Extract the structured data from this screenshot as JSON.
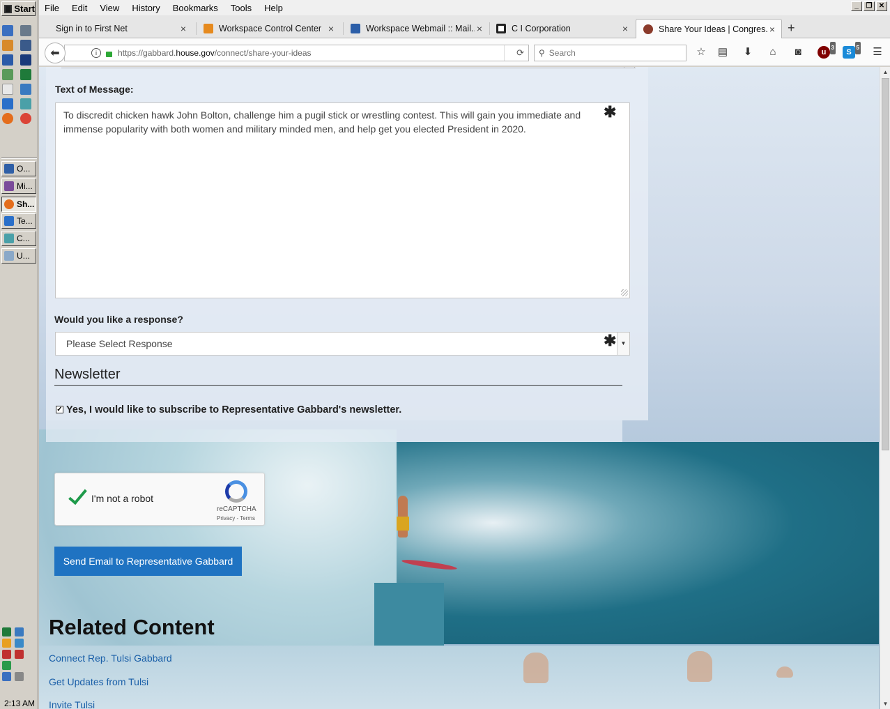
{
  "taskbar": {
    "start_label": "Start",
    "tasks": [
      {
        "label": "O...",
        "color": "#2f5fa6"
      },
      {
        "label": "Mi...",
        "color": "#7a4a9a"
      },
      {
        "label": "Sh...",
        "color": "#e46d1c"
      },
      {
        "label": "Te...",
        "color": "#2a6fc9"
      },
      {
        "label": "C...",
        "color": "#4aa0a8"
      },
      {
        "label": "U...",
        "color": "#8aa8c8"
      }
    ],
    "clock": "2:13 AM"
  },
  "menubar": {
    "items": [
      "File",
      "Edit",
      "View",
      "History",
      "Bookmarks",
      "Tools",
      "Help"
    ]
  },
  "tabs": [
    {
      "label": "Sign in to First Net",
      "close": "×"
    },
    {
      "label": "Workspace Control Center",
      "close": "×",
      "favicon_color": "#e68a1e"
    },
    {
      "label": "Workspace Webmail :: Mail...",
      "close": "×",
      "favicon_color": "#2b5ea8"
    },
    {
      "label": "C I Corporation",
      "close": "×",
      "favicon_color": "#222222"
    },
    {
      "label": "Share Your Ideas | Congres...",
      "close": "×",
      "favicon_color": "#8a3a2a"
    }
  ],
  "newtab_label": "+",
  "navbar": {
    "url_prefix": "https://gabbard.",
    "url_domain": "house.gov",
    "url_path": "/connect/share-your-ideas",
    "search_placeholder": "Search",
    "ublock_count": "3",
    "skype_count": "5"
  },
  "form": {
    "message_label": "Text of Message:",
    "message_text": "To discredit chicken hawk John Bolton, challenge him a pugil stick or wrestling contest.  This will gain you immediate and immense popularity with both women and military minded men, and help get you elected President in 2020.",
    "required_mark": "✱",
    "response_label": "Would you like a response?",
    "response_value": "Please Select Response",
    "newsletter_title": "Newsletter",
    "newsletter_checked": "✓",
    "newsletter_label": "Yes, I would like to subscribe to Representative Gabbard's newsletter.",
    "captcha_label": "I'm not a robot",
    "captcha_brand": "reCAPTCHA",
    "captcha_terms": "Privacy - Terms",
    "send_label": "Send Email to Representative Gabbard"
  },
  "related": {
    "title": "Related Content",
    "links": [
      "Connect Rep. Tulsi Gabbard",
      "Get Updates from Tulsi",
      "Invite Tulsi"
    ]
  },
  "colors": {
    "send_button": "#1f73c2",
    "link": "#1a5fa8",
    "captcha_check": "#1e9a4a"
  }
}
